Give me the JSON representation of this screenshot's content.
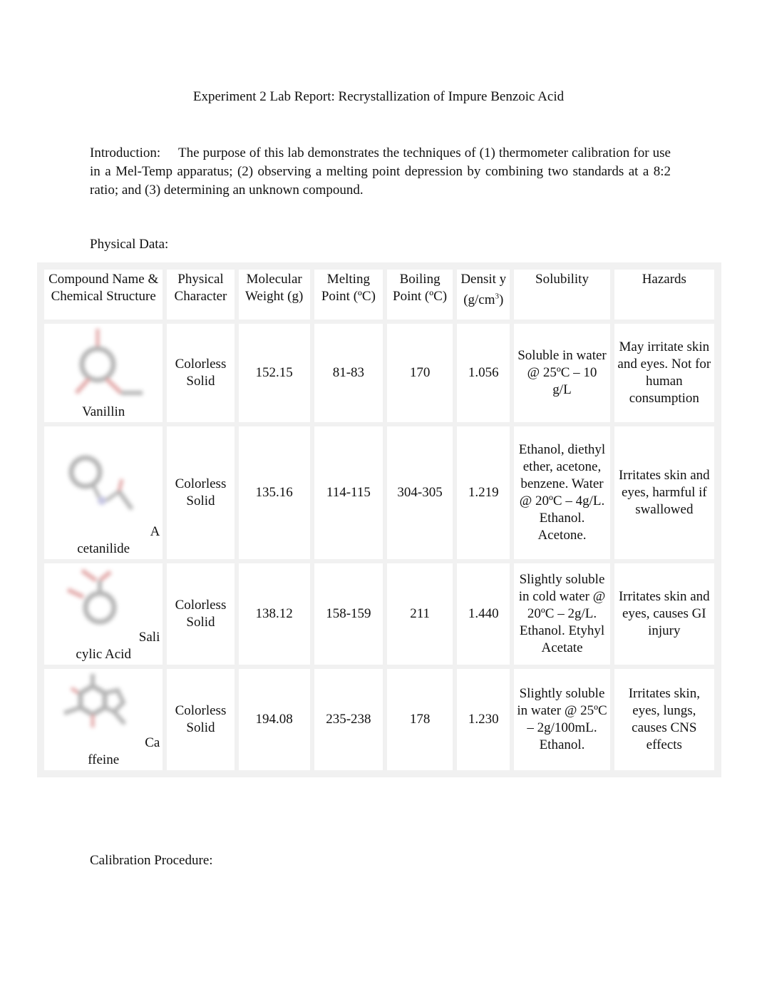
{
  "document": {
    "title": "Experiment 2 Lab Report: Recrystallization of Impure Benzoic Acid",
    "introduction": {
      "label": "Introduction:",
      "text": "The purpose of this lab demonstrates the techniques of (1) thermometer calibration for use in a Mel-Temp apparatus; (2) observing a melting point depression by combining two standards at a 8:2 ratio; and (3) determining an unknown compound."
    },
    "physical_data_label": "Physical Data:",
    "calibration_label": "Calibration Procedure:"
  },
  "table": {
    "headers": [
      "Compound Name & Chemical Structure",
      "Physical Character",
      "Molecular Weight (g)",
      "Melting Point (ºC)",
      "Boiling Point (ºC)",
      "Densit y",
      "Solubility",
      "Hazards"
    ],
    "density_unit": "(g/cm",
    "density_unit_sup": "3",
    "density_unit_close": ")",
    "rows": [
      {
        "name_line1": "",
        "name_line2": "Vanillin",
        "structure_icon": "vanillin-structure",
        "character": "Colorless Solid",
        "mw": "152.15",
        "mp": "81-83",
        "bp": "170",
        "density": "1.056",
        "solubility": "Soluble in water @ 25ºC – 10 g/L",
        "hazards": "May irritate skin and eyes. Not for human consumption"
      },
      {
        "name_line1": "A",
        "name_line2": "cetanilide",
        "structure_icon": "acetanilide-structure",
        "character": "Colorless Solid",
        "mw": "135.16",
        "mp": "114-115",
        "bp": "304-305",
        "density": "1.219",
        "solubility": "Ethanol, diethyl ether, acetone, benzene. Water @ 20ºC – 4g/L. Ethanol. Acetone.",
        "hazards": "Irritates skin and eyes, harmful if swallowed"
      },
      {
        "name_line1": "Sali",
        "name_line2": "cylic Acid",
        "structure_icon": "salicylic-acid-structure",
        "character": "Colorless Solid",
        "mw": "138.12",
        "mp": "158-159",
        "bp": "211",
        "density": "1.440",
        "solubility": "Slightly soluble in cold water @ 20ºC – 2g/L. Ethanol. Etyhyl Acetate",
        "hazards": "Irritates skin and eyes, causes GI injury"
      },
      {
        "name_line1": "Ca",
        "name_line2": "ffeine",
        "structure_icon": "caffeine-structure",
        "character": "Colorless Solid",
        "mw": "194.08",
        "mp": "235-238",
        "bp": "178",
        "density": "1.230",
        "solubility": "Slightly soluble in water @ 25ºC – 2g/100mL. Ethanol.",
        "hazards": "Irritates skin, eyes, lungs, causes CNS effects"
      }
    ]
  }
}
